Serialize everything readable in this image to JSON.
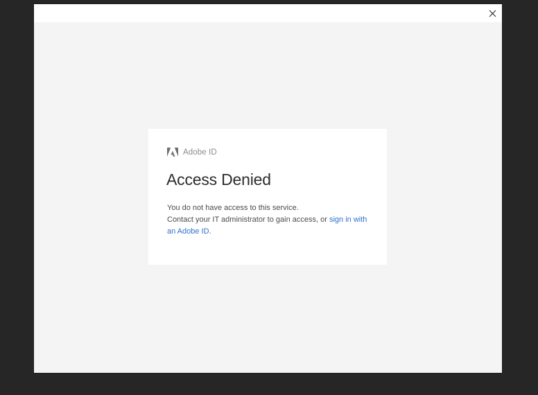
{
  "dialog": {
    "close_icon": "close-icon"
  },
  "card": {
    "brand_logo_icon": "adobe-logo-icon",
    "brand_label": "Adobe ID",
    "title": "Access Denied",
    "line1": "You do not have access to this service.",
    "line2_prefix": "Contact your IT administrator to gain access, or ",
    "link_text": "sign in with an Adobe ID",
    "line2_suffix": "."
  },
  "colors": {
    "backdrop": "#262626",
    "dialog_bg": "#f4f4f4",
    "card_bg": "#ffffff",
    "link": "#2d6fcf",
    "title": "#2c2c2c",
    "body_text": "#4b4b4b",
    "brand_text": "#8a8a8a"
  }
}
